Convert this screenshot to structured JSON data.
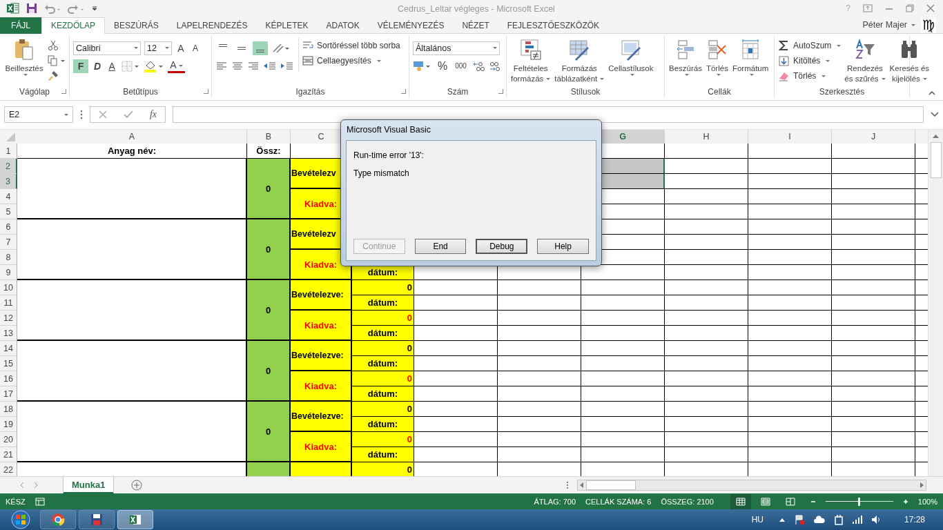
{
  "title_bar": {
    "title": "Cedrus_Leltar végleges - Microsoft Excel",
    "help": "?"
  },
  "ribbon_tabs": [
    {
      "label": "FÁJL",
      "kind": "file",
      "selected": false
    },
    {
      "label": "KEZDŐLAP",
      "kind": "tab",
      "selected": true
    },
    {
      "label": "BESZÚRÁS",
      "kind": "tab",
      "selected": false
    },
    {
      "label": "LAPELRENDEZÉS",
      "kind": "tab",
      "selected": false
    },
    {
      "label": "KÉPLETEK",
      "kind": "tab",
      "selected": false
    },
    {
      "label": "ADATOK",
      "kind": "tab",
      "selected": false
    },
    {
      "label": "VÉLEMÉNYEZÉS",
      "kind": "tab",
      "selected": false
    },
    {
      "label": "NÉZET",
      "kind": "tab",
      "selected": false
    },
    {
      "label": "FEJLESZTŐESZKÖZÖK",
      "kind": "tab",
      "selected": false
    }
  ],
  "account": {
    "name": "Péter Majer",
    "avatar": "♍"
  },
  "ribbon": {
    "clipboard": {
      "paste": "Beillesztés",
      "group": "Vágólap"
    },
    "font": {
      "name": "Calibri",
      "size": "12",
      "grow": "A",
      "shrink": "A",
      "font_color": "A",
      "group": "Betűtípus",
      "styles": [
        {
          "label": "F",
          "kind": "bold",
          "selected": true
        },
        {
          "label": "D",
          "kind": "italic",
          "selected": false
        },
        {
          "label": "A",
          "kind": "underline",
          "selected": false
        }
      ]
    },
    "alignment": {
      "vertical": [
        {
          "kind": "top",
          "selected": false
        },
        {
          "kind": "middle",
          "selected": false
        },
        {
          "kind": "bottom",
          "selected": true
        }
      ],
      "wrap": "Sortöréssel több sorba",
      "merge": "Cellaegyesítés",
      "group": "Igazítás"
    },
    "number": {
      "format": "Általános",
      "percent": "%",
      "thousands": "000",
      "group": "Szám"
    },
    "styles": {
      "group": "Stílusok",
      "buttons": [
        {
          "kind": "conditional",
          "lines": [
            "Feltételes",
            "formázás"
          ]
        },
        {
          "kind": "table",
          "lines": [
            "Formázás",
            "táblázatként"
          ]
        },
        {
          "kind": "cellstyle",
          "lines": [
            "Cellastílusok"
          ]
        }
      ]
    },
    "cells": {
      "group": "Cellák",
      "buttons": [
        {
          "kind": "insert",
          "label": "Beszúrás"
        },
        {
          "kind": "delete",
          "label": "Törlés"
        },
        {
          "kind": "format",
          "label": "Formátum"
        }
      ]
    },
    "editing": {
      "group": "Szerkesztés",
      "small": [
        {
          "kind": "autosum",
          "label": "AutoSzum"
        },
        {
          "kind": "fill",
          "label": "Kitöltés"
        },
        {
          "kind": "clear",
          "label": "Törlés"
        }
      ],
      "big": [
        {
          "kind": "sort",
          "lines": [
            "Rendezés",
            "és szűrés"
          ]
        },
        {
          "kind": "find",
          "lines": [
            "Keresés és",
            "kijelölés"
          ]
        }
      ]
    }
  },
  "formula_bar": {
    "name_box": "E2",
    "fx": "fx"
  },
  "sheet": {
    "column_headers": [
      {
        "label": "A",
        "selected": false
      },
      {
        "label": "B",
        "selected": false
      },
      {
        "label": "C",
        "selected": false
      },
      {
        "label": "G",
        "selected": true
      },
      {
        "label": "H",
        "selected": false
      },
      {
        "label": "I",
        "selected": false
      },
      {
        "label": "J",
        "selected": false
      }
    ],
    "rows": [
      {
        "num": "1",
        "selected": false
      },
      {
        "num": "2",
        "selected": true
      },
      {
        "num": "3",
        "selected": true
      },
      {
        "num": "4",
        "selected": false
      },
      {
        "num": "5",
        "selected": false
      },
      {
        "num": "6",
        "selected": false
      },
      {
        "num": "7",
        "selected": false
      },
      {
        "num": "8",
        "selected": false
      },
      {
        "num": "9",
        "selected": false
      },
      {
        "num": "10",
        "selected": false
      },
      {
        "num": "11",
        "selected": false
      },
      {
        "num": "12",
        "selected": false
      },
      {
        "num": "13",
        "selected": false
      },
      {
        "num": "14",
        "selected": false
      },
      {
        "num": "15",
        "selected": false
      },
      {
        "num": "16",
        "selected": false
      },
      {
        "num": "17",
        "selected": false
      },
      {
        "num": "18",
        "selected": false
      },
      {
        "num": "19",
        "selected": false
      },
      {
        "num": "20",
        "selected": false
      },
      {
        "num": "21",
        "selected": false
      },
      {
        "num": "22",
        "selected": false
      }
    ],
    "header_row": [
      "Anyag név:",
      "Össz:"
    ],
    "blocks": [
      {
        "total": "0",
        "in_label": "Bevételezv",
        "out_label": "Kiadva:"
      },
      {
        "total": "0",
        "in_label": "Bevételezv",
        "out_label": "Kiadva:",
        "out_date": "dátum:"
      },
      {
        "total": "0",
        "in_label": "Bevételezve:",
        "in_value": "0",
        "in_date": "dátum:",
        "out_label": "Kiadva:",
        "out_value": "0",
        "out_date": "dátum:"
      },
      {
        "total": "0",
        "in_label": "Bevételezve:",
        "in_value": "0",
        "in_date": "dátum:",
        "out_label": "Kiadva:",
        "out_value": "0",
        "out_date": "dátum:"
      },
      {
        "total": "0",
        "in_label": "Bevételezve:",
        "in_value": "0",
        "in_date": "dátum:",
        "out_label": "Kiadva:",
        "out_value": "0",
        "out_date": "dátum:"
      },
      {
        "in_value": "0"
      }
    ]
  },
  "dialog": {
    "title": "Microsoft Visual Basic",
    "error": "Run-time error '13':",
    "message": "Type mismatch",
    "buttons": [
      {
        "label": "Continue",
        "disabled": true,
        "focused": false
      },
      {
        "label": "End",
        "disabled": false,
        "focused": false
      },
      {
        "label": "Debug",
        "disabled": false,
        "focused": true
      },
      {
        "label": "Help",
        "disabled": false,
        "focused": false
      }
    ]
  },
  "sheet_tabs": [
    {
      "label": "Munka1",
      "selected": true
    }
  ],
  "status_bar": {
    "mode": "KÉSZ",
    "average": "ÁTLAG: 700",
    "count": "CELLÁK SZÁMA: 6",
    "sum": "ÖSSZEG: 2100",
    "views": [
      {
        "kind": "normal",
        "selected": true
      },
      {
        "kind": "page_layout",
        "selected": false
      },
      {
        "kind": "page_break",
        "selected": false
      }
    ],
    "zoom": {
      "level": 0.5,
      "reading": "100%"
    }
  },
  "taskbar": {
    "apps": [
      {
        "kind": "chrome",
        "selected": false
      },
      {
        "kind": "save",
        "selected": false
      },
      {
        "kind": "excel",
        "selected": true
      }
    ],
    "language": "HU",
    "clock": "17:28"
  }
}
